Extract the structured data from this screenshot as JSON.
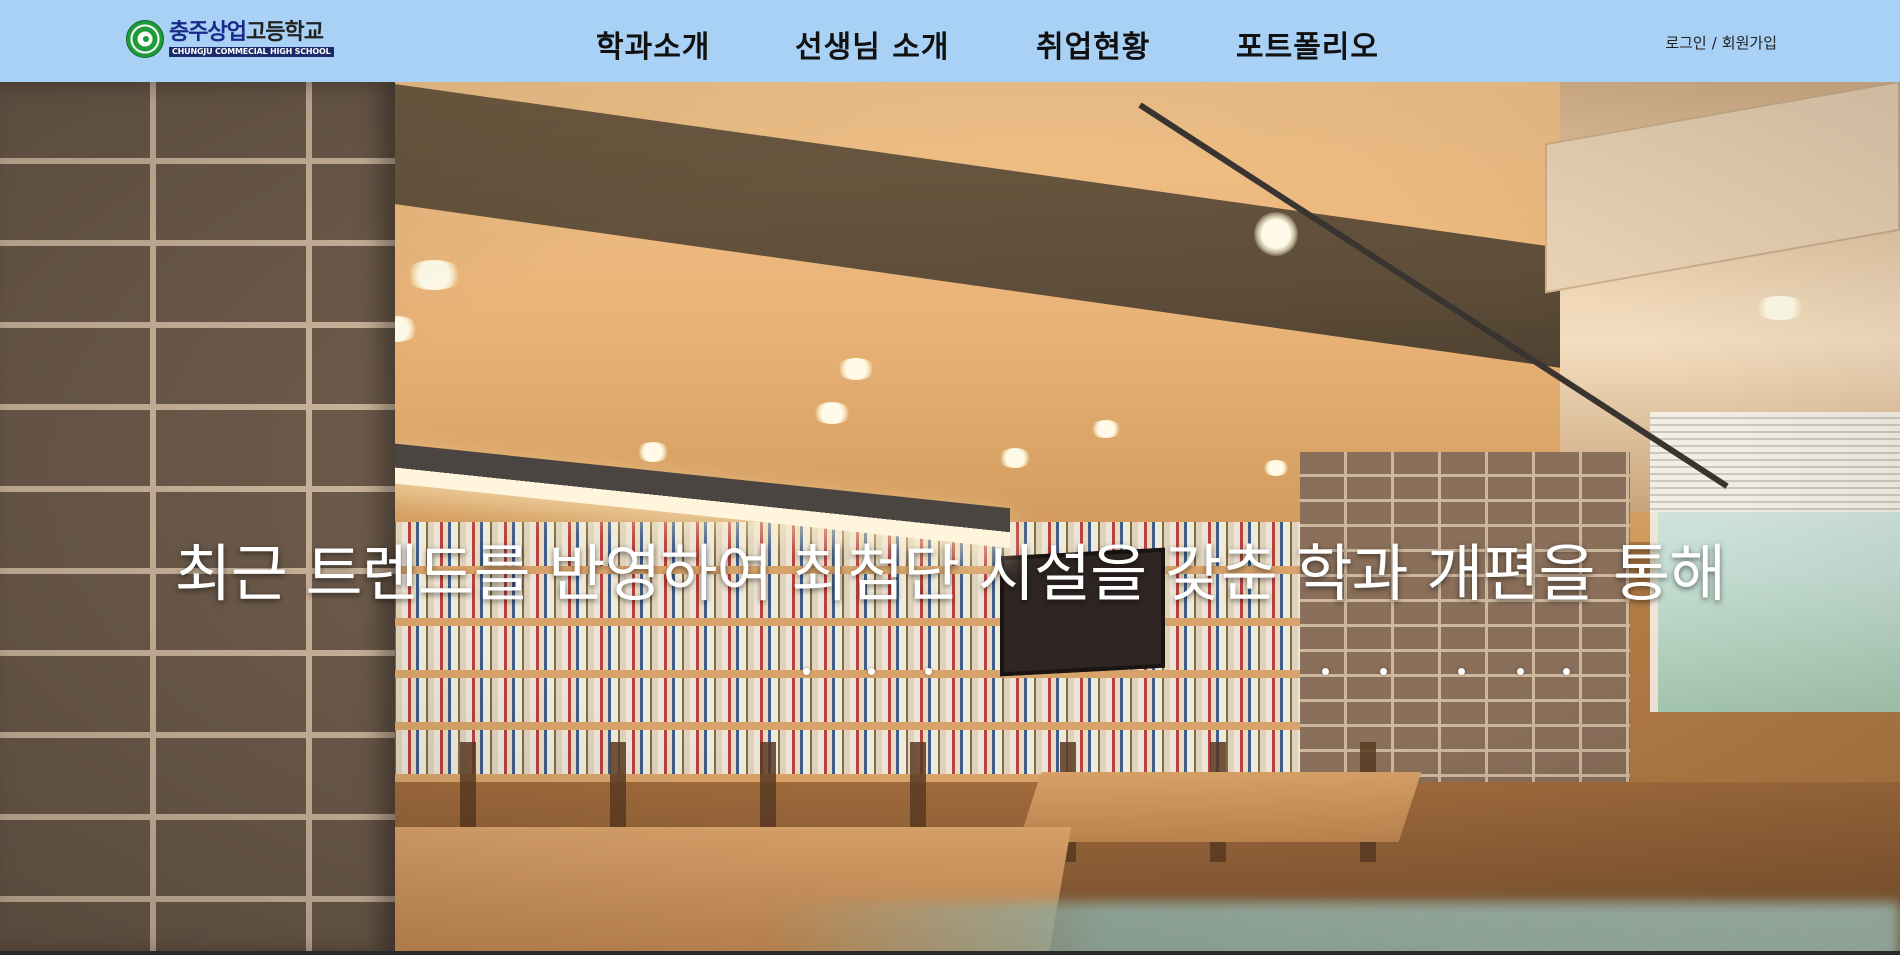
{
  "header": {
    "logo": {
      "name_part1": "충주상업",
      "name_part2": "고등학교",
      "subtitle": "CHUNGJU COMMECIAL HIGH SCHOOL",
      "icon": "school-emblem-icon"
    },
    "nav": [
      {
        "label": "학과소개"
      },
      {
        "label": "선생님 소개"
      },
      {
        "label": "취업현황"
      },
      {
        "label": "포트폴리오"
      }
    ],
    "auth": {
      "login": "로그인",
      "separator": "/",
      "signup": "회원가입"
    }
  },
  "hero": {
    "caption": "최근 트렌드를 반영하여 최첨단 시설을 갖춘 학과 개편을 통해",
    "slide_indicator_count": 8
  },
  "colors": {
    "header_bg": "#a9d0f5",
    "logo_navy": "#1a2a8a",
    "logo_green": "#1e9a3a",
    "caption": "#ffffff"
  }
}
